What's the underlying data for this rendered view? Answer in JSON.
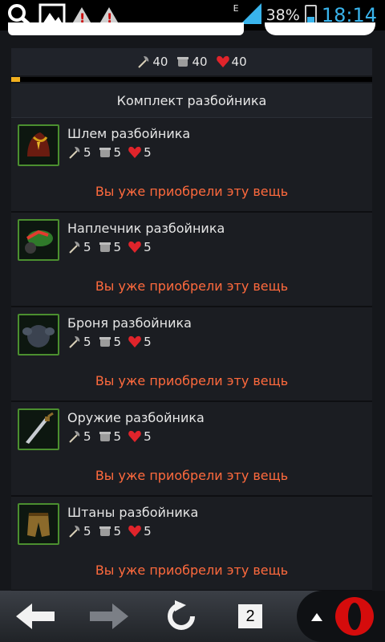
{
  "statusbar": {
    "battery_percent": "38%",
    "time": "18:14",
    "network_label": "E"
  },
  "stats_summary": {
    "attack": "40",
    "defense": "40",
    "health": "40"
  },
  "progress_fraction": 0.025,
  "panel": {
    "title": "Комплект разбойника",
    "items": [
      {
        "name": "Шлем разбойника",
        "attack": "5",
        "defense": "5",
        "health": "5",
        "status": "Вы уже приобрели эту вещь",
        "icon": "helmet-icon"
      },
      {
        "name": "Наплечник разбойника",
        "attack": "5",
        "defense": "5",
        "health": "5",
        "status": "Вы уже приобрели эту вещь",
        "icon": "shoulder-icon"
      },
      {
        "name": "Броня разбойника",
        "attack": "5",
        "defense": "5",
        "health": "5",
        "status": "Вы уже приобрели эту вещь",
        "icon": "armor-icon"
      },
      {
        "name": "Оружие разбойника",
        "attack": "5",
        "defense": "5",
        "health": "5",
        "status": "Вы уже приобрели эту вещь",
        "icon": "sword-icon"
      },
      {
        "name": "Штаны разбойника",
        "attack": "5",
        "defense": "5",
        "health": "5",
        "status": "Вы уже приобрели эту вещь",
        "icon": "pants-icon"
      }
    ]
  },
  "bottomnav": {
    "tabs_count": "2"
  },
  "colors": {
    "accent_orange": "#ff6a3d",
    "android_blue": "#39b4ec",
    "item_border_green": "#4b8f2f"
  }
}
